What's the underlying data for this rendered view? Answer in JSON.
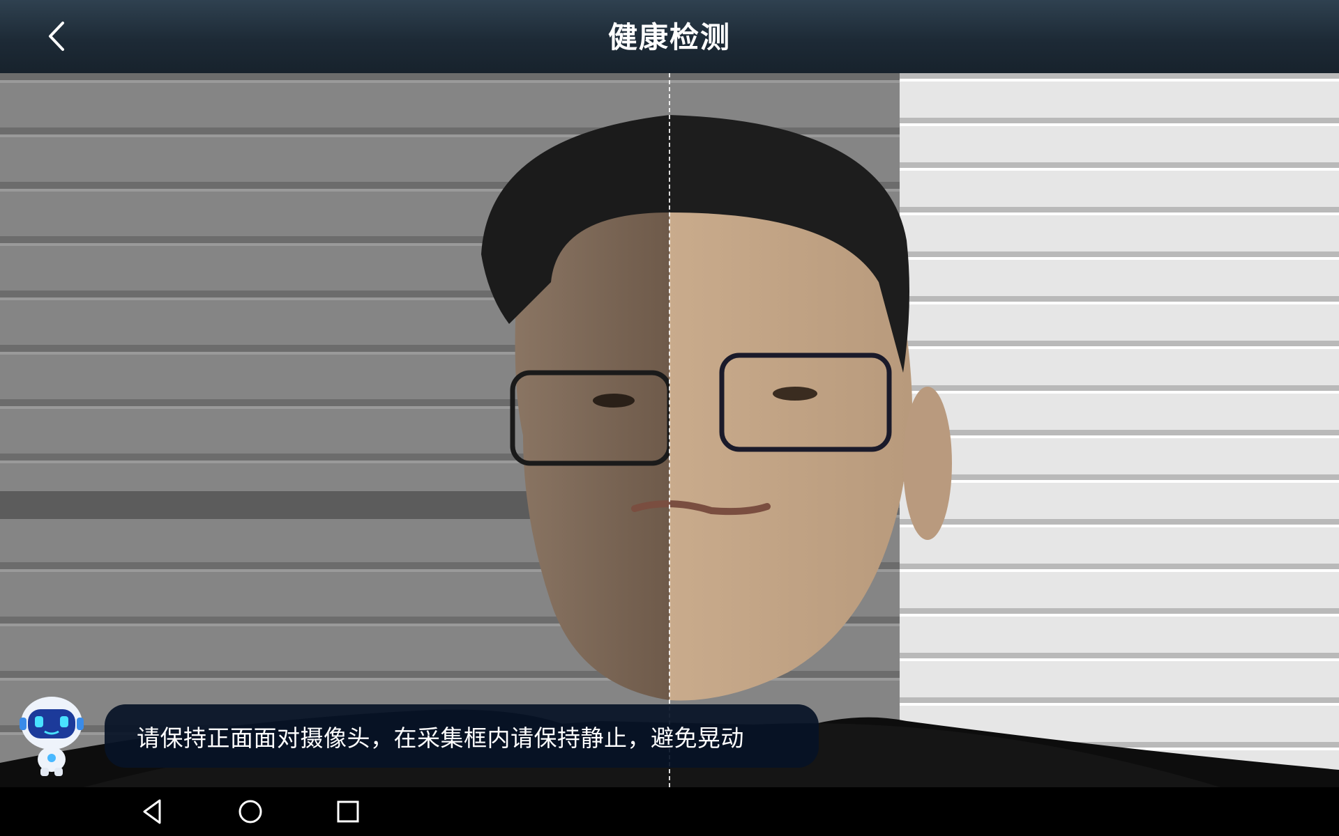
{
  "header": {
    "title": "健康检测",
    "back_icon": "chevron-left-icon"
  },
  "camera": {
    "guide": "vertical-dashed-center-line"
  },
  "tip": {
    "mascot_icon": "robot-mascot-icon",
    "text": "请保持正面面对摄像头，在采集框内请保持静止，避免晃动"
  },
  "navbar": {
    "back_icon": "nav-back-triangle-icon",
    "home_icon": "nav-home-circle-icon",
    "recents_icon": "nav-recents-square-icon"
  },
  "colors": {
    "header_bg": "#1d2a36",
    "tip_bg": "#061226",
    "text": "#ffffff"
  }
}
